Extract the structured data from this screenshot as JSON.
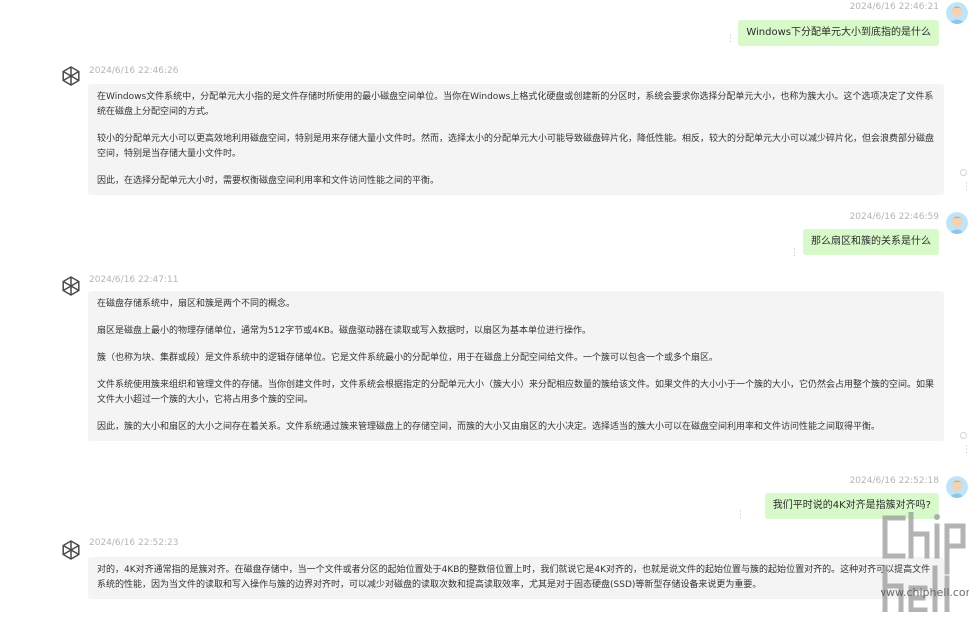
{
  "messages": [
    {
      "role": "user",
      "timestamp": "2024/6/16 22:46:21",
      "text": "Windows下分配单元大小到底指的是什么"
    },
    {
      "role": "assistant",
      "timestamp": "2024/6/16 22:46:26",
      "paragraphs": [
        "在Windows文件系统中，分配单元大小指的是文件存储时所使用的最小磁盘空间单位。当你在Windows上格式化硬盘或创建新的分区时，系统会要求你选择分配单元大小，也称为簇大小。这个选项决定了文件系统在磁盘上分配空间的方式。",
        "较小的分配单元大小可以更高效地利用磁盘空间，特别是用来存储大量小文件时。然而，选择太小的分配单元大小可能导致磁盘碎片化，降低性能。相反，较大的分配单元大小可以减少碎片化，但会浪费部分磁盘空间，特别是当存储大量小文件时。",
        "因此，在选择分配单元大小时，需要权衡磁盘空间利用率和文件访问性能之间的平衡。"
      ]
    },
    {
      "role": "user",
      "timestamp": "2024/6/16 22:46:59",
      "text": "那么扇区和簇的关系是什么"
    },
    {
      "role": "assistant",
      "timestamp": "2024/6/16 22:47:11",
      "paragraphs": [
        "在磁盘存储系统中，扇区和簇是两个不同的概念。",
        "扇区是磁盘上最小的物理存储单位，通常为512字节或4KB。磁盘驱动器在读取或写入数据时，以扇区为基本单位进行操作。",
        "簇（也称为块、集群或段）是文件系统中的逻辑存储单位。它是文件系统最小的分配单位，用于在磁盘上分配空间给文件。一个簇可以包含一个或多个扇区。",
        "文件系统使用簇来组织和管理文件的存储。当你创建文件时，文件系统会根据指定的分配单元大小（簇大小）来分配相应数量的簇给该文件。如果文件的大小小于一个簇的大小，它仍然会占用整个簇的空间。如果文件大小超过一个簇的大小，它将占用多个簇的空间。",
        "因此，簇的大小和扇区的大小之间存在着关系。文件系统通过簇来管理磁盘上的存储空间，而簇的大小又由扇区的大小决定。选择适当的簇大小可以在磁盘空间利用率和文件访问性能之间取得平衡。"
      ]
    },
    {
      "role": "user",
      "timestamp": "2024/6/16 22:52:18",
      "text": "我们平时说的4K对齐是指簇对齐吗?"
    },
    {
      "role": "assistant",
      "timestamp": "2024/6/16 22:52:23",
      "paragraphs": [
        "对的，4K对齐通常指的是簇对齐。在磁盘存储中，当一个文件或者分区的起始位置处于4KB的整数倍位置上时，我们就说它是4K对齐的，也就是说文件的起始位置与簇的起始位置对齐的。这种对齐可以提高文件系统的性能，因为当文件的读取和写入操作与簇的边界对齐时，可以减少对磁盘的读取次数和提高读取效率，尤其是对于固态硬盘(SSD)等新型存储设备来说更为重要。"
      ]
    }
  ],
  "watermark": {
    "text": "www.chiphell.com"
  },
  "colors": {
    "user_bubble": "#d8f9c9",
    "bot_bubble": "#f4f4f4",
    "timestamp": "#b5b5b5"
  },
  "icons": {
    "user_avatar": "user-avatar-icon",
    "assistant_avatar": "openai-logo-icon",
    "more": "more-vertical-icon",
    "regenerate": "circle-icon"
  }
}
